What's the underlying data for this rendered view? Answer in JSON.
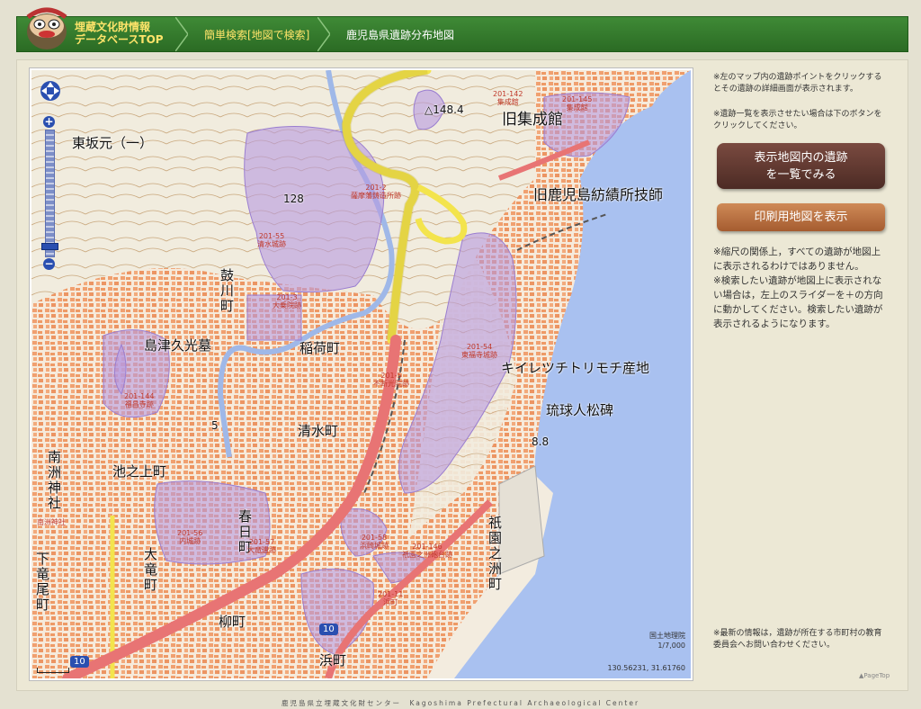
{
  "header": {
    "logo_line1": "埋蔵文化財情報",
    "logo_line2": "データベースTOP",
    "crumb_search": "簡単検索[地図で検索]",
    "crumb_current": "鹿児島県遺跡分布地図"
  },
  "map": {
    "place_labels": {
      "higashisakamoto": "東坂元（一）",
      "tsuzumikawa": "鼓川町",
      "shimazu": "島津久光墓",
      "inari": "稲荷町",
      "shimizu": "清水町",
      "ikenoue": "池之上町",
      "kasuga": "春日町",
      "ootatsu": "大竜町",
      "yanagi": "柳町",
      "hama": "浜町",
      "gion": "祇園之洲町",
      "shimotatsuo": "下竜尾町",
      "nanshu": "南洲神社",
      "kyushuseikan": "旧集成館",
      "boseki": "旧鹿児島紡績所技師",
      "kiiretsu": "キイレツチトリモチ産地",
      "ryukyu": "琉球人松碑",
      "elev_148": "△148.4",
      "elev_128": "128",
      "elev_8": "8.8",
      "elev_5": "5",
      "road_10": "10",
      "road_10b": "10",
      "nanshu_shrine": "南洲神社"
    },
    "site_labels": {
      "s142": "201-142\n集成館",
      "s145": "201-145\n集成館",
      "s55": "201-55\n清水城跡",
      "s_a": "201-2\n薩摩藩鋳造所跡",
      "s54": "201-54\n東福寺城跡",
      "s_b": "201-3\n大乗院跡",
      "s144": "201-144\n福昌寺跡",
      "s_c": "201-5\n不断光院跡",
      "s56": "201-56\n内城跡",
      "s_d": "201-57\n大竜遺跡",
      "s58": "201-58\n浜崎城跡",
      "s146": "201-146\n祇園之洲砲台跡",
      "s_e": "201-11\n浜町"
    },
    "attribution_line1": "国土地理院",
    "attribution_line2": "1/7,000",
    "coords": "130.56231, 31.61760",
    "colors": {
      "water": "#a9c1f0",
      "site": "#b79ae0",
      "road_main": "#e87474",
      "road_yellow": "#f3e44d"
    }
  },
  "side": {
    "note1": "※左のマップ内の遺跡ポイントをクリックするとその遺跡の詳細画面が表示されます。",
    "note2": "※遺跡一覧を表示させたい場合は下のボタンをクリックしてください。",
    "list_button": "表示地図内の遺跡\nを一覧でみる",
    "print_button": "印刷用地図を表示",
    "note3": "※縮尺の関係上，すべての遺跡が地図上に表示されるわけではありません。\n※検索したい遺跡が地図上に表示されない場合は，左上のスライダーを＋の方向に動かしてください。検索したい遺跡が表示されるようになります。",
    "note4": "※最新の情報は，遺跡が所在する市町村の教育委員会へお問い合わせください。",
    "pagetop": "▲PageTop"
  },
  "footer": "鹿児島県立埋蔵文化財センター　Kagoshima Prefectural Archaeological Center"
}
